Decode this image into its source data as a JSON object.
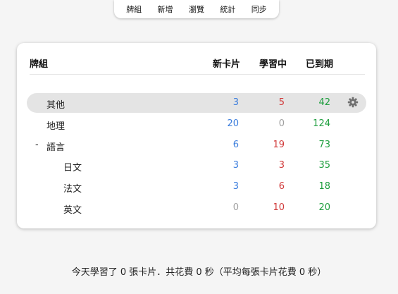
{
  "toolbar": {
    "items": [
      "牌組",
      "新增",
      "瀏覽",
      "統計",
      "同步"
    ]
  },
  "table": {
    "headers": {
      "deck": "牌組",
      "new": "新卡片",
      "learning": "學習中",
      "due": "已到期"
    },
    "rows": [
      {
        "name": "其他",
        "new": "3",
        "learning": "5",
        "due": "42",
        "selected": true
      },
      {
        "name": "地理",
        "new": "20",
        "learning": "0",
        "due": "124"
      },
      {
        "name": "語言",
        "toggle": "-",
        "new": "6",
        "learning": "19",
        "due": "73"
      },
      {
        "name": "日文",
        "new": "3",
        "learning": "3",
        "due": "35"
      },
      {
        "name": "法文",
        "new": "3",
        "learning": "6",
        "due": "18"
      },
      {
        "name": "英文",
        "new": "0",
        "learning": "10",
        "due": "20"
      }
    ]
  },
  "footer": {
    "text": "今天學習了 0 張卡片．共花費 0 秒（平均每張卡片花費 0 秒）"
  },
  "colors": {
    "new": "#3b7ddd",
    "learning": "#d13a3a",
    "due": "#1e9e3e",
    "zero": "#a0a0a0"
  },
  "icons": {
    "options": "gear-icon"
  }
}
